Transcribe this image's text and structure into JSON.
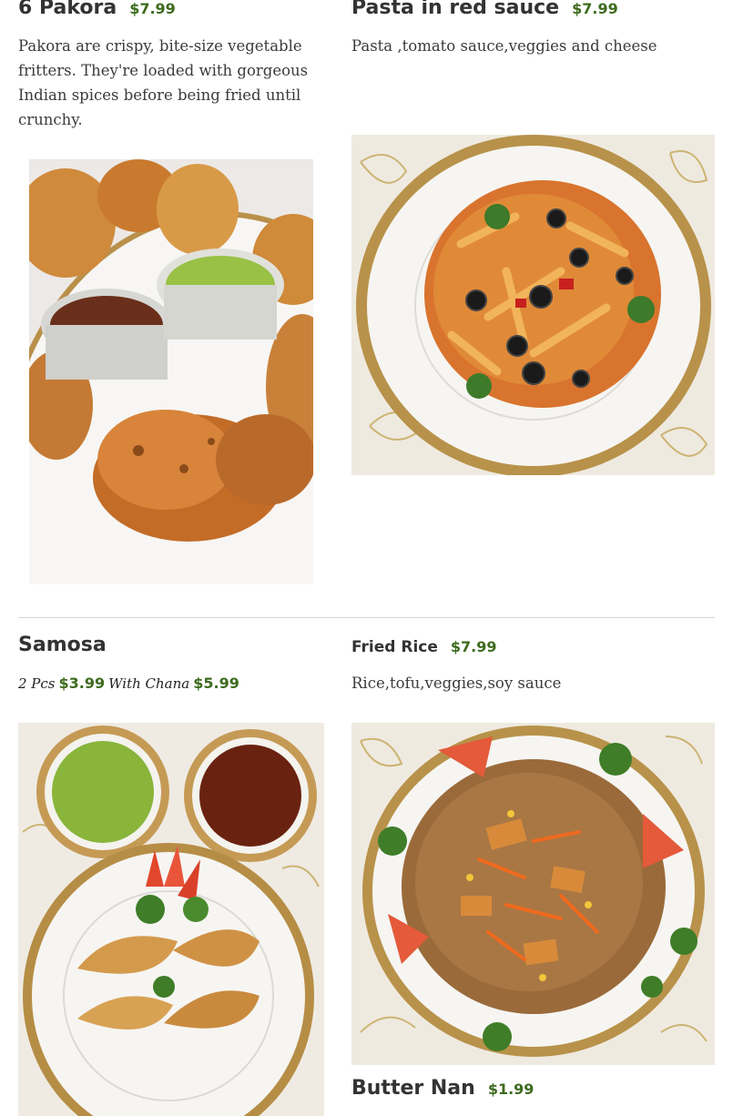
{
  "menu_items": [
    {
      "name": "6 Pakora",
      "price": "$7.99",
      "description": "Pakora are crispy, bite-size vegetable fritters. They're loaded with gorgeous Indian spices before being fried until crunchy.",
      "image_icon": "pakora-photo"
    },
    {
      "name": "Pasta in red sauce",
      "price": "$7.99",
      "description": "Pasta ,tomato sauce,veggies and cheese",
      "image_icon": "pasta-photo"
    },
    {
      "name": "Samosa",
      "variants": [
        {
          "label": "2 Pcs",
          "price": "$3.99"
        },
        {
          "label": "With Chana",
          "price": "$5.99"
        }
      ],
      "image_icon": "samosa-photo"
    },
    {
      "name": "Fried Rice",
      "price": "$7.99",
      "description": "Rice,tofu,veggies,soy sauce",
      "image_icon": "fried-rice-photo"
    },
    {
      "name": "Butter Nan",
      "price": "$1.99"
    }
  ],
  "colors": {
    "price": "#3d6b1e",
    "title": "#333333",
    "divider": "#d8d8d8"
  }
}
